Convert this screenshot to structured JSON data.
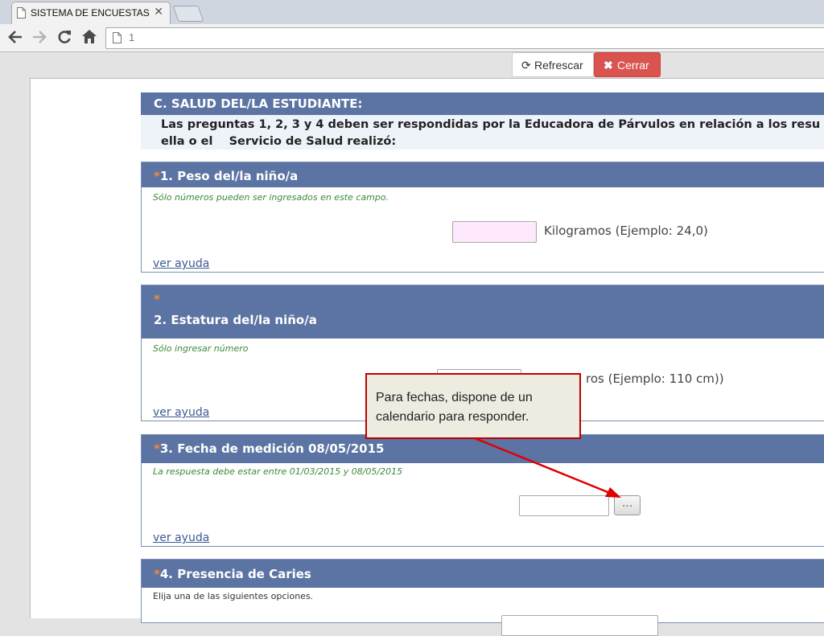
{
  "browser": {
    "tab_title": "SISTEMA DE ENCUESTAS -",
    "tab_close": "✕",
    "url": "1",
    "back_icon": "back-arrow-icon",
    "forward_icon": "forward-arrow-icon",
    "reload_icon": "reload-icon",
    "home_icon": "home-icon"
  },
  "toolbar": {
    "refresh_label": "Refrescar",
    "refresh_icon": "⟳",
    "close_label": "Cerrar",
    "close_icon": "✖"
  },
  "section": {
    "title": "C. SALUD DEL/LA ESTUDIANTE:",
    "desc_line1": "Las preguntas 1, 2, 3 y 4 deben ser respondidas por la Educadora de Párvulos en relación a los resu",
    "desc_line2": "ella o el    Servicio de Salud realizó:"
  },
  "questions": [
    {
      "star": "*",
      "title": "1. Peso del/la niño/a",
      "hint": "Sólo números pueden ser ingresados en este campo.",
      "unit": "Kilogramos (Ejemplo: 24,0)",
      "help": "ver ayuda"
    },
    {
      "star": "*",
      "title": "2. Estatura del/la niño/a",
      "hint": "Sólo ingresar número",
      "unit": "ros (Ejemplo: 110 cm))",
      "help": "ver ayuda"
    },
    {
      "star": "*",
      "title": "3. Fecha de medición 08/05/2015",
      "hint": "La respuesta debe estar entre 01/03/2015 y 08/05/2015",
      "button": "...",
      "help": "ver ayuda"
    },
    {
      "star": "*",
      "title": "4. Presencia de Caries",
      "hint": "Elija una de las siguientes opciones."
    }
  ],
  "callout": {
    "line1": "Para fechas, dispone de un",
    "line2": "calendario para responder."
  },
  "colors": {
    "header_blue": "#5b74a3",
    "star_orange": "#f0883a",
    "hint_green": "#3a8a3a",
    "close_red": "#d9534f",
    "callout_border": "#c00000"
  }
}
